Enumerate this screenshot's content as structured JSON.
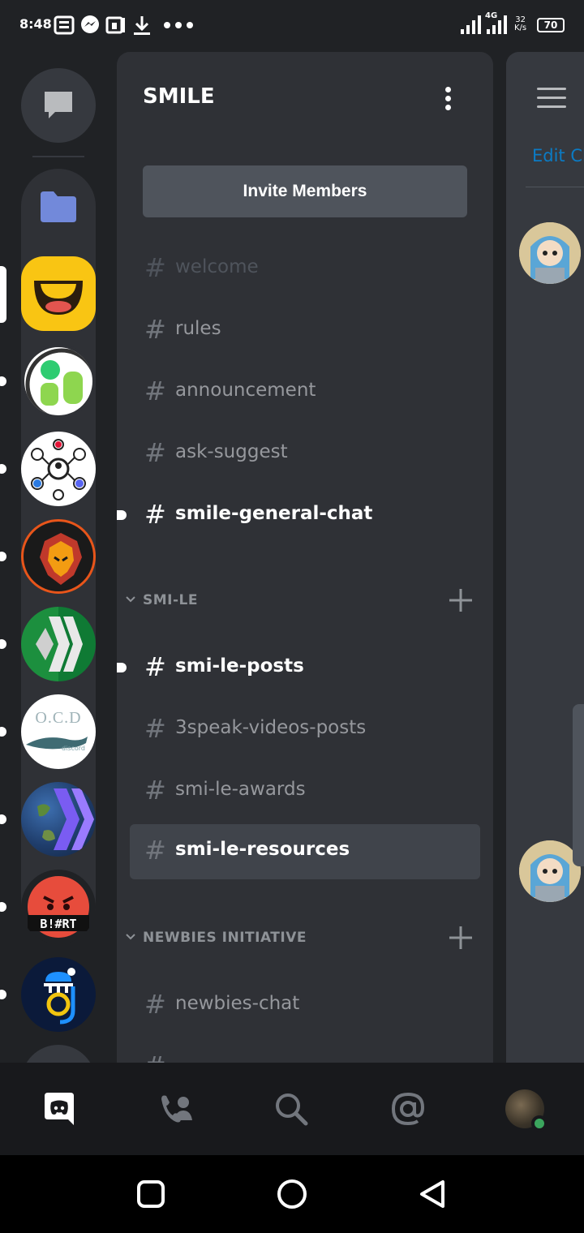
{
  "status_bar": {
    "time": "8:48",
    "network": "4G",
    "speed_value": "32",
    "speed_unit": "K/s",
    "battery": "70"
  },
  "guild_rail": {
    "items": [
      {
        "name": "direct-messages",
        "icon": "chat-bubble-icon"
      },
      {
        "name": "folder",
        "icon": "folder-icon",
        "color": "#7289da"
      },
      {
        "name": "smile-server",
        "icon": "smile-logo",
        "selected": true
      },
      {
        "name": "guild-2",
        "icon": "green-blocks-logo",
        "unread": true
      },
      {
        "name": "guild-3",
        "icon": "network-logo",
        "unread": true
      },
      {
        "name": "guild-4",
        "icon": "lion-logo",
        "unread": true
      },
      {
        "name": "guild-5",
        "icon": "hive-logo",
        "unread": true
      },
      {
        "name": "guild-6",
        "icon": "ocd-logo",
        "unread": true
      },
      {
        "name": "guild-7",
        "icon": "earth-hive-logo",
        "unread": true
      },
      {
        "name": "guild-8",
        "icon": "angry-face-logo",
        "unread": true
      },
      {
        "name": "guild-9",
        "icon": "ho-logo",
        "unread": true
      }
    ],
    "logo_text": {
      "ocd": "O.C.D",
      "ocd_sub": "discord",
      "angry": "B!#RT"
    }
  },
  "sidebar": {
    "server_name": "SMILE",
    "invite_label": "Invite Members",
    "channels_top": [
      {
        "name": "welcome",
        "state": "muted"
      },
      {
        "name": "rules",
        "state": "normal"
      },
      {
        "name": "announcement",
        "state": "normal"
      },
      {
        "name": "ask-suggest",
        "state": "normal"
      },
      {
        "name": "smile-general-chat",
        "state": "unread"
      }
    ],
    "categories": [
      {
        "name": "SMI-LE",
        "channels": [
          {
            "name": "smi-le-posts",
            "state": "unread"
          },
          {
            "name": "3speak-videos-posts",
            "state": "normal"
          },
          {
            "name": "smi-le-awards",
            "state": "normal"
          },
          {
            "name": "smi-le-resources",
            "state": "selected"
          }
        ]
      },
      {
        "name": "NEWBIES INITIATIVE",
        "channels": [
          {
            "name": "newbies-chat",
            "state": "normal"
          }
        ]
      }
    ],
    "hash": "#"
  },
  "peek_panel": {
    "edit_text": "Edit Ch"
  },
  "colors": {
    "blurple": "#5865f2",
    "online": "#3ba55d",
    "link": "#0b7bc4"
  }
}
